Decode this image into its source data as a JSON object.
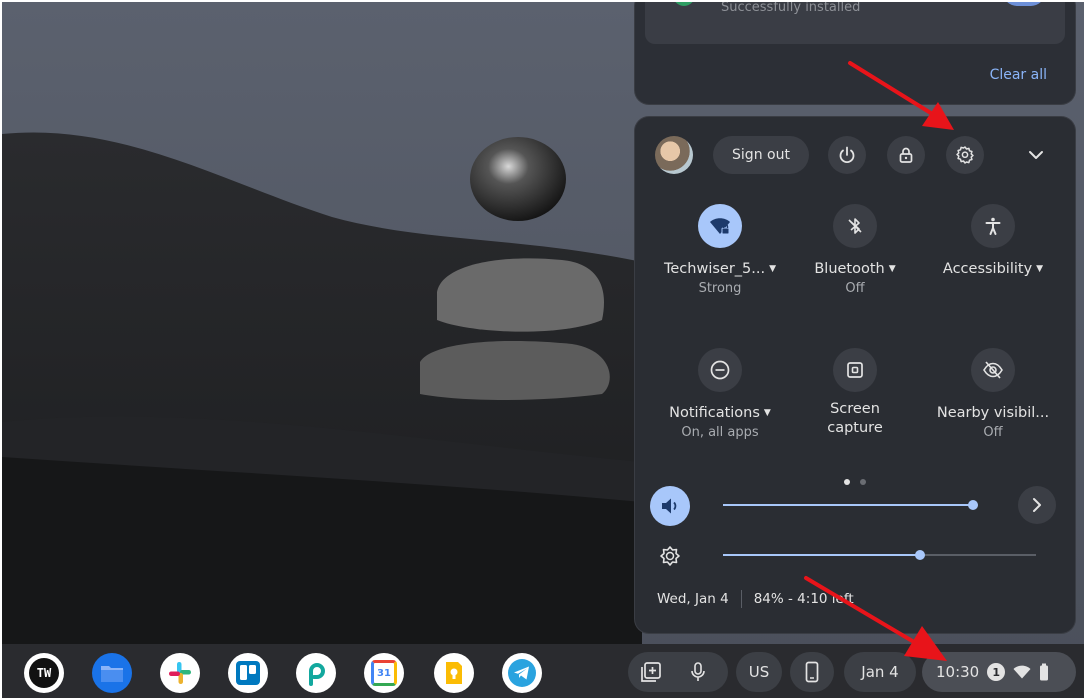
{
  "notification": {
    "status_text": "Successfully installed",
    "clear_all_label": "Clear all"
  },
  "quick_settings": {
    "sign_out_label": "Sign out",
    "header_icons": [
      "power-icon",
      "lock-icon",
      "gear-icon",
      "chevron-down-icon"
    ],
    "tiles": [
      {
        "label": "Techwiser_5...",
        "sub": "Strong",
        "active": true,
        "icon": "wifi-lock-icon"
      },
      {
        "label": "Bluetooth",
        "sub": "Off",
        "active": false,
        "icon": "bluetooth-icon"
      },
      {
        "label": "Accessibility",
        "sub": "",
        "active": false,
        "icon": "accessibility-icon"
      },
      {
        "label": "Notifications",
        "sub": "On, all apps",
        "active": false,
        "icon": "notifications-icon"
      },
      {
        "label_line1": "Screen",
        "label_line2": "capture",
        "active": false,
        "icon": "screen-capture-icon"
      },
      {
        "label": "Nearby visibil...",
        "sub": "Off",
        "active": false,
        "icon": "nearby-visibility-icon"
      }
    ],
    "page_dots": {
      "count": 2,
      "active": 0
    },
    "volume_level": 0.98,
    "brightness_level": 0.63,
    "date": "Wed, Jan 4",
    "battery": "84% - 4:10 left"
  },
  "shelf": {
    "apps": [
      "techwiser-icon",
      "files-icon",
      "slack-icon",
      "trello-icon",
      "picsart-icon",
      "calendar-icon",
      "keep-icon",
      "telegram-icon"
    ],
    "app_labels": {
      "techwiser": "TW",
      "calendar": "31"
    },
    "input_method": "US",
    "date_pill": "Jan 4",
    "time": "10:30",
    "notification_count": "1"
  },
  "colors": {
    "panel": "#2a2d33",
    "accent": "#a8c7fa",
    "link": "#8ab4f8",
    "arrow": "#e8141a"
  }
}
